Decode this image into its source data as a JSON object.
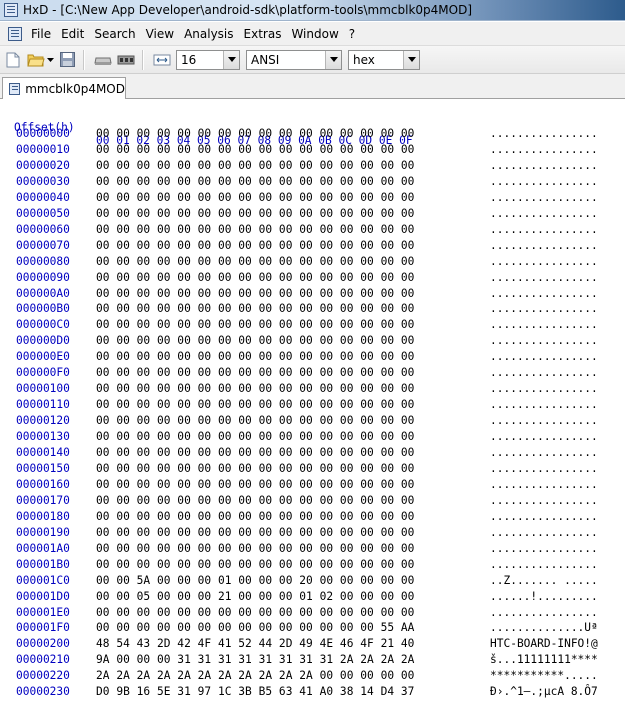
{
  "window": {
    "title": "HxD - [C:\\New App Developer\\android-sdk\\platform-tools\\mmcblk0p4MOD]",
    "app_icon": "hxd-app-icon"
  },
  "menu": [
    "File",
    "Edit",
    "Search",
    "View",
    "Analysis",
    "Extras",
    "Window",
    "?"
  ],
  "toolbar": {
    "bytes_per_row": "16",
    "charset": "ANSI",
    "offset_base": "hex",
    "icons": [
      "new-file-icon",
      "open-folder-icon",
      "save-icon",
      "disk-icon",
      "ram-icon",
      "column-width-icon"
    ]
  },
  "tab": {
    "label": "mmcblk0p4MOD"
  },
  "hex": {
    "offset_header": "Offset(h)",
    "column_header": "00 01 02 03 04 05 06 07 08 09 0A 0B 0C 0D 0E 0F",
    "rows": [
      {
        "offset": "00000000",
        "bytes": "00 00 00 00 00 00 00 00 00 00 00 00 00 00 00 00",
        "ascii": "................"
      },
      {
        "offset": "00000010",
        "bytes": "00 00 00 00 00 00 00 00 00 00 00 00 00 00 00 00",
        "ascii": "................"
      },
      {
        "offset": "00000020",
        "bytes": "00 00 00 00 00 00 00 00 00 00 00 00 00 00 00 00",
        "ascii": "................"
      },
      {
        "offset": "00000030",
        "bytes": "00 00 00 00 00 00 00 00 00 00 00 00 00 00 00 00",
        "ascii": "................"
      },
      {
        "offset": "00000040",
        "bytes": "00 00 00 00 00 00 00 00 00 00 00 00 00 00 00 00",
        "ascii": "................"
      },
      {
        "offset": "00000050",
        "bytes": "00 00 00 00 00 00 00 00 00 00 00 00 00 00 00 00",
        "ascii": "................"
      },
      {
        "offset": "00000060",
        "bytes": "00 00 00 00 00 00 00 00 00 00 00 00 00 00 00 00",
        "ascii": "................"
      },
      {
        "offset": "00000070",
        "bytes": "00 00 00 00 00 00 00 00 00 00 00 00 00 00 00 00",
        "ascii": "................"
      },
      {
        "offset": "00000080",
        "bytes": "00 00 00 00 00 00 00 00 00 00 00 00 00 00 00 00",
        "ascii": "................"
      },
      {
        "offset": "00000090",
        "bytes": "00 00 00 00 00 00 00 00 00 00 00 00 00 00 00 00",
        "ascii": "................"
      },
      {
        "offset": "000000A0",
        "bytes": "00 00 00 00 00 00 00 00 00 00 00 00 00 00 00 00",
        "ascii": "................"
      },
      {
        "offset": "000000B0",
        "bytes": "00 00 00 00 00 00 00 00 00 00 00 00 00 00 00 00",
        "ascii": "................"
      },
      {
        "offset": "000000C0",
        "bytes": "00 00 00 00 00 00 00 00 00 00 00 00 00 00 00 00",
        "ascii": "................"
      },
      {
        "offset": "000000D0",
        "bytes": "00 00 00 00 00 00 00 00 00 00 00 00 00 00 00 00",
        "ascii": "................"
      },
      {
        "offset": "000000E0",
        "bytes": "00 00 00 00 00 00 00 00 00 00 00 00 00 00 00 00",
        "ascii": "................"
      },
      {
        "offset": "000000F0",
        "bytes": "00 00 00 00 00 00 00 00 00 00 00 00 00 00 00 00",
        "ascii": "................"
      },
      {
        "offset": "00000100",
        "bytes": "00 00 00 00 00 00 00 00 00 00 00 00 00 00 00 00",
        "ascii": "................"
      },
      {
        "offset": "00000110",
        "bytes": "00 00 00 00 00 00 00 00 00 00 00 00 00 00 00 00",
        "ascii": "................"
      },
      {
        "offset": "00000120",
        "bytes": "00 00 00 00 00 00 00 00 00 00 00 00 00 00 00 00",
        "ascii": "................"
      },
      {
        "offset": "00000130",
        "bytes": "00 00 00 00 00 00 00 00 00 00 00 00 00 00 00 00",
        "ascii": "................"
      },
      {
        "offset": "00000140",
        "bytes": "00 00 00 00 00 00 00 00 00 00 00 00 00 00 00 00",
        "ascii": "................"
      },
      {
        "offset": "00000150",
        "bytes": "00 00 00 00 00 00 00 00 00 00 00 00 00 00 00 00",
        "ascii": "................"
      },
      {
        "offset": "00000160",
        "bytes": "00 00 00 00 00 00 00 00 00 00 00 00 00 00 00 00",
        "ascii": "................"
      },
      {
        "offset": "00000170",
        "bytes": "00 00 00 00 00 00 00 00 00 00 00 00 00 00 00 00",
        "ascii": "................"
      },
      {
        "offset": "00000180",
        "bytes": "00 00 00 00 00 00 00 00 00 00 00 00 00 00 00 00",
        "ascii": "................"
      },
      {
        "offset": "00000190",
        "bytes": "00 00 00 00 00 00 00 00 00 00 00 00 00 00 00 00",
        "ascii": "................"
      },
      {
        "offset": "000001A0",
        "bytes": "00 00 00 00 00 00 00 00 00 00 00 00 00 00 00 00",
        "ascii": "................"
      },
      {
        "offset": "000001B0",
        "bytes": "00 00 00 00 00 00 00 00 00 00 00 00 00 00 00 00",
        "ascii": "................"
      },
      {
        "offset": "000001C0",
        "bytes": "00 00 5A 00 00 00 01 00 00 00 20 00 00 00 00 00",
        "ascii": "..Z....... ....."
      },
      {
        "offset": "000001D0",
        "bytes": "00 00 05 00 00 00 21 00 00 00 01 02 00 00 00 00",
        "ascii": "......!........."
      },
      {
        "offset": "000001E0",
        "bytes": "00 00 00 00 00 00 00 00 00 00 00 00 00 00 00 00",
        "ascii": "................"
      },
      {
        "offset": "000001F0",
        "bytes": "00 00 00 00 00 00 00 00 00 00 00 00 00 00 55 AA",
        "ascii": "..............Uª"
      },
      {
        "offset": "00000200",
        "bytes": "48 54 43 2D 42 4F 41 52 44 2D 49 4E 46 4F 21 40",
        "ascii": "HTC-BOARD-INFO!@"
      },
      {
        "offset": "00000210",
        "bytes": "9A 00 00 00 31 31 31 31 31 31 31 31 2A 2A 2A 2A",
        "ascii": "š...11111111****"
      },
      {
        "offset": "00000220",
        "bytes": "2A 2A 2A 2A 2A 2A 2A 2A 2A 2A 2A 00 00 00 00 00",
        "ascii": "***********....."
      },
      {
        "offset": "00000230",
        "bytes": "D0 9B 16 5E 31 97 1C 3B B5 63 41 A0 38 14 D4 37",
        "ascii": "Ð›.^1—.;µcA 8.Ô7"
      }
    ]
  }
}
